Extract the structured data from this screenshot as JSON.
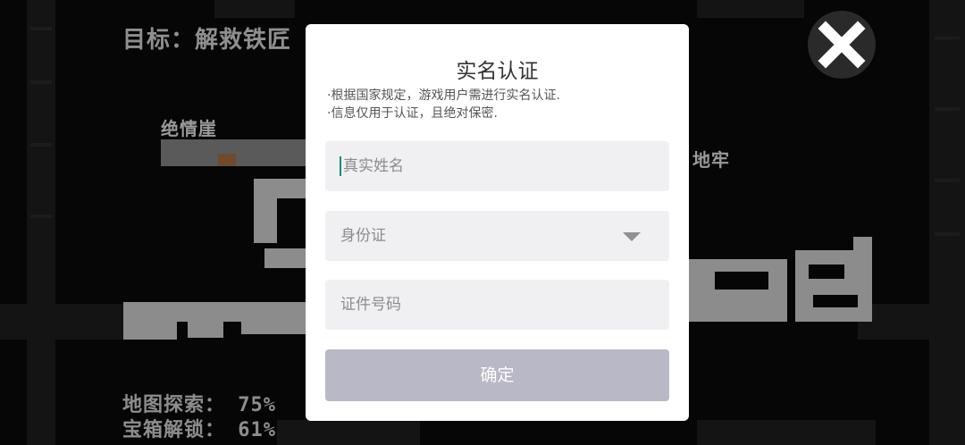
{
  "game": {
    "objective": "目标：解救铁匠",
    "areas": {
      "cliff": "绝情崖",
      "dungeon": "地牢"
    },
    "stats": {
      "map_explored": "地图探索：  75%",
      "chests_unlocked": "宝箱解锁：  61%"
    },
    "close_icon": "close-icon",
    "colors": {
      "map_wall": "#8c8c8c",
      "background": "#060606"
    }
  },
  "dialog": {
    "title": "实名认证",
    "notice_lines": [
      "·根据国家规定，游戏用户需进行实名认证.",
      "·信息仅用于认证，且绝对保密."
    ],
    "name_field": {
      "placeholder": "真实姓名",
      "value": ""
    },
    "id_type_select": {
      "selected": "身份证",
      "icon": "triangle-down-icon"
    },
    "id_number_field": {
      "placeholder": "证件号码",
      "value": ""
    },
    "confirm_label": "确定",
    "colors": {
      "field_bg": "#f0f0f2",
      "button_bg": "#b9b8c6",
      "caret": "#0e8a80"
    }
  }
}
